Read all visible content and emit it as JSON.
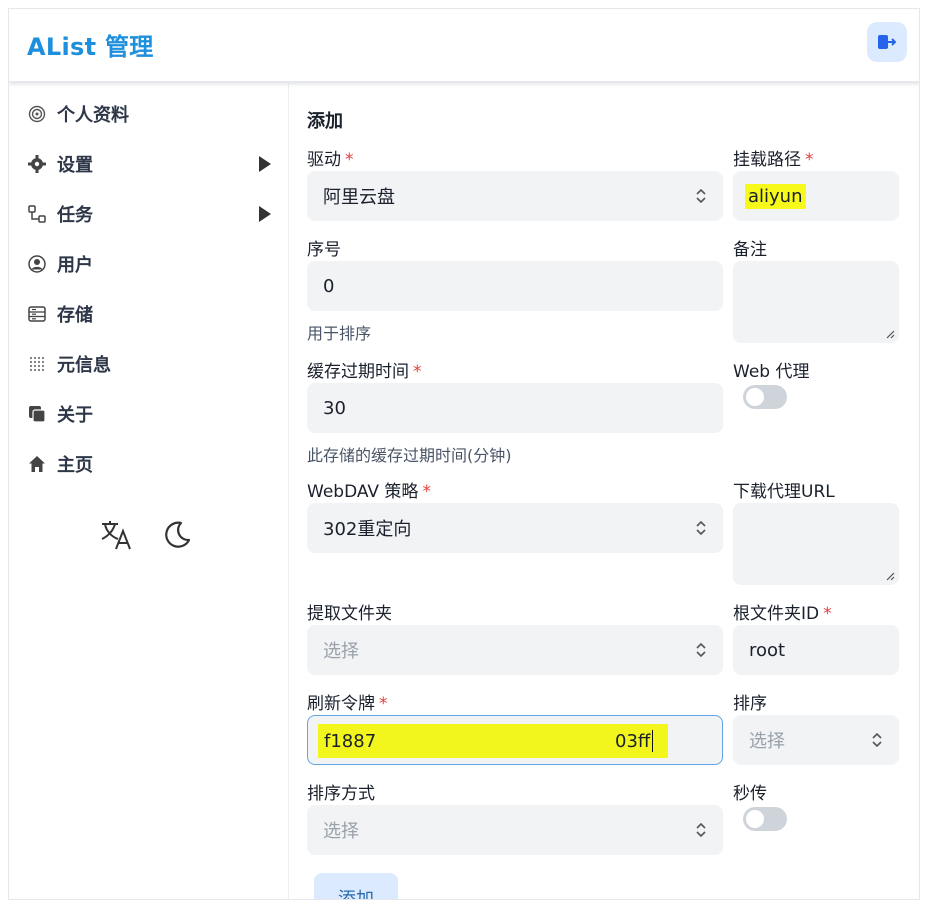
{
  "header": {
    "brand": "AList 管理",
    "logout_icon": "logout-icon"
  },
  "sidebar": {
    "items": [
      {
        "label": "个人资料",
        "icon": "fingerprint-icon"
      },
      {
        "label": "设置",
        "icon": "gear-icon"
      },
      {
        "label": "任务",
        "icon": "tasks-icon"
      },
      {
        "label": "用户",
        "icon": "user-circle-icon"
      },
      {
        "label": "存储",
        "icon": "storage-icon"
      },
      {
        "label": "元信息",
        "icon": "meta-icon"
      },
      {
        "label": "关于",
        "icon": "about-icon"
      },
      {
        "label": "主页",
        "icon": "home-icon"
      }
    ],
    "tools": [
      "translate-icon",
      "moon-icon"
    ]
  },
  "form": {
    "title": "添加",
    "driver": {
      "label": "驱动",
      "value": "阿里云盘"
    },
    "mount_path": {
      "label": "挂载路径",
      "value": "aliyun"
    },
    "order": {
      "label": "序号",
      "value": "0",
      "hint": "用于排序"
    },
    "remark": {
      "label": "备注",
      "value": ""
    },
    "cache_expiration": {
      "label": "缓存过期时间",
      "value": "30",
      "hint": "此存储的缓存过期时间(分钟)"
    },
    "web_proxy": {
      "label": "Web 代理",
      "enabled": false
    },
    "webdav_policy": {
      "label": "WebDAV 策略",
      "value": "302重定向"
    },
    "download_proxy_url": {
      "label": "下载代理URL",
      "value": ""
    },
    "extract_folder": {
      "label": "提取文件夹",
      "placeholder": "选择"
    },
    "root_folder_id": {
      "label": "根文件夹ID",
      "value": "root"
    },
    "refresh_token": {
      "label": "刷新令牌",
      "value_start": "f1887",
      "value_end": "03ff"
    },
    "order_by": {
      "label": "排序",
      "placeholder": "选择"
    },
    "order_direction": {
      "label": "排序方式",
      "placeholder": "选择"
    },
    "rapid_upload": {
      "label": "秒传",
      "enabled": false
    },
    "submit_label": "添加"
  },
  "colors": {
    "brand": "#1e8fdc",
    "required": "#e53e3e",
    "highlight": "#f6f91a",
    "button_bg": "#dbeafe"
  }
}
